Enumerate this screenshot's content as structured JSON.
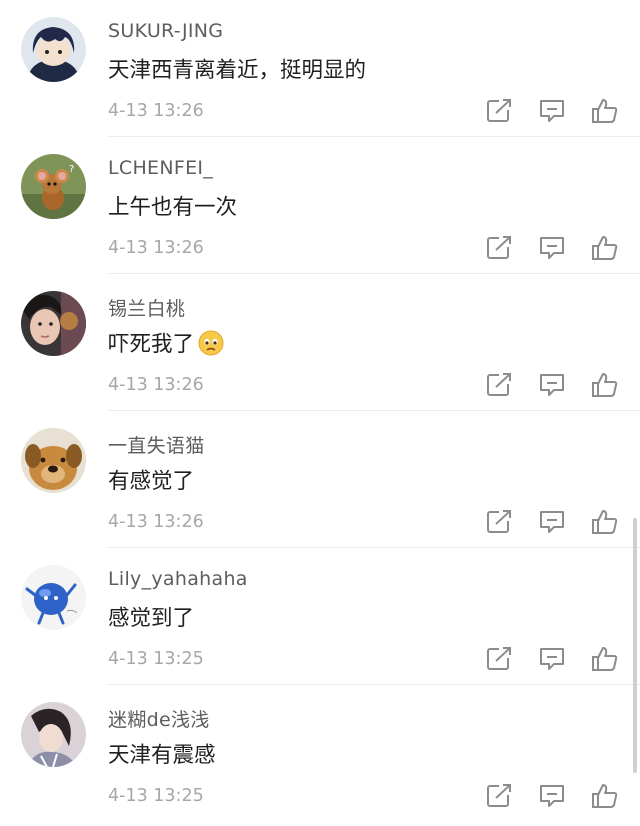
{
  "colors": {
    "username": "#5d5d5d",
    "text": "#1f1f1f",
    "time": "#a7a7a7",
    "icon": "#8c8c8c",
    "divider": "#ececec"
  },
  "comments": [
    {
      "username": "SUKUR-JING",
      "text": "天津西青离着近，挺明显的",
      "time": "4-13 13:26",
      "avatar": "anime-boy-avatar"
    },
    {
      "username": "LCHENFEI_",
      "text": "上午也有一次",
      "time": "4-13 13:26",
      "avatar": "cartoon-mouse-avatar"
    },
    {
      "username": "锡兰白桃",
      "text": "吓死我了",
      "emoji": "worried-face",
      "time": "4-13 13:26",
      "avatar": "photo-girl-avatar"
    },
    {
      "username": "一直失语猫",
      "text": "有感觉了",
      "time": "4-13 13:26",
      "avatar": "dog-avatar"
    },
    {
      "username": "Lily_yahahaha",
      "text": "感觉到了",
      "time": "4-13 13:25",
      "avatar": "blue-creature-avatar"
    },
    {
      "username": "迷糊de浅浅",
      "text": "天津有震感",
      "time": "4-13 13:25",
      "avatar": "photo-person-avatar"
    }
  ],
  "actions": [
    "share-icon",
    "reply-icon",
    "like-icon"
  ]
}
